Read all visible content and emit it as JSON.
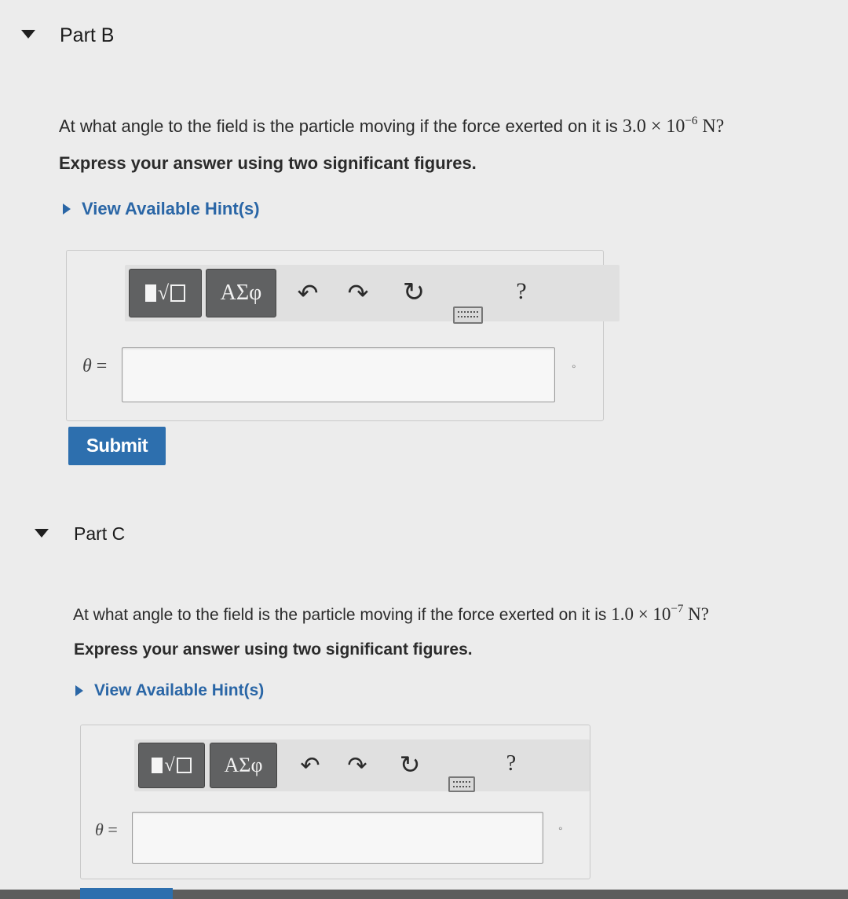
{
  "part_b": {
    "title": "Part B",
    "question_text": "At what angle to the field is the particle moving if the force exerted on it is ",
    "force_coefficient": "3.0 × 10",
    "force_exponent": "−6",
    "force_unit": " N?",
    "instruction": "Express your answer using two significant figures.",
    "hint_label": "View Available Hint(s)",
    "toolbar": {
      "symbols_label": "ΑΣφ",
      "undo": "↶",
      "redo": "↷",
      "reset": "↻",
      "help": "?"
    },
    "variable_label": "θ",
    "equals": " =",
    "input_value": "",
    "unit": "°",
    "submit_label": "Submit"
  },
  "part_c": {
    "title": "Part C",
    "question_text": "At what angle to the field is the particle moving if the force exerted on it is ",
    "force_coefficient": "1.0 × 10",
    "force_exponent": "−7",
    "force_unit": " N?",
    "instruction": "Express your answer using two significant figures.",
    "hint_label": "View Available Hint(s)",
    "toolbar": {
      "symbols_label": "ΑΣφ",
      "undo": "↶",
      "redo": "↷",
      "reset": "↻",
      "help": "?"
    },
    "variable_label": "θ",
    "equals": " =",
    "input_value": "",
    "unit": "°"
  },
  "icons": {
    "collapse": "triangle-down-icon",
    "hint_expand": "triangle-right-icon",
    "templates": "templates-icon",
    "symbols": "greek-symbols-icon",
    "undo": "undo-icon",
    "redo": "redo-icon",
    "reset": "reset-icon",
    "keyboard": "keyboard-icon",
    "help": "help-icon"
  },
  "colors": {
    "accent": "#2d6fae",
    "hint": "#2a66a6",
    "background": "#ececec"
  }
}
